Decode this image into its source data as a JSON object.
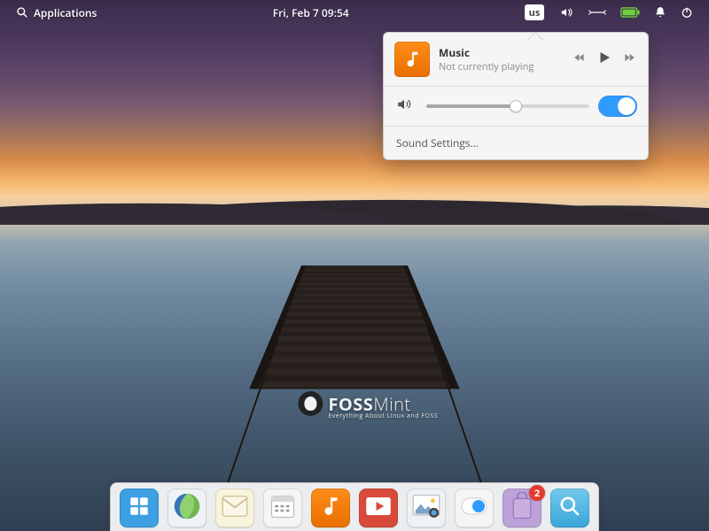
{
  "panel": {
    "applications_label": "Applications",
    "clock": "Fri, Feb 7   09:54",
    "keyboard_layout": "us"
  },
  "sound_popover": {
    "app_title": "Music",
    "status": "Not currently playing",
    "volume_percent": 55,
    "output_enabled": true,
    "settings_label": "Sound Settings…"
  },
  "watermark": {
    "brand_left": "FOSS",
    "brand_right": "Mint",
    "tagline": "Everything About Linux and FOSS"
  },
  "dock": {
    "items": [
      {
        "name": "multitasking",
        "bg": "#3da0e3"
      },
      {
        "name": "web-browser",
        "bg": "#eef2f4"
      },
      {
        "name": "mail",
        "bg": "#f7f3dc"
      },
      {
        "name": "calendar",
        "bg": "#f5f5f5"
      },
      {
        "name": "music",
        "bg": "linear-gradient(#ff8c1a,#e86f00)"
      },
      {
        "name": "videos",
        "bg": "#d84b3c"
      },
      {
        "name": "photos",
        "bg": "#eef2f4"
      },
      {
        "name": "switchboard",
        "bg": "#f5f5f5"
      },
      {
        "name": "app-center",
        "bg": "#bda2d9",
        "badge": "2"
      },
      {
        "name": "search",
        "bg": "linear-gradient(#73c8ec,#39a7d9)"
      }
    ]
  }
}
